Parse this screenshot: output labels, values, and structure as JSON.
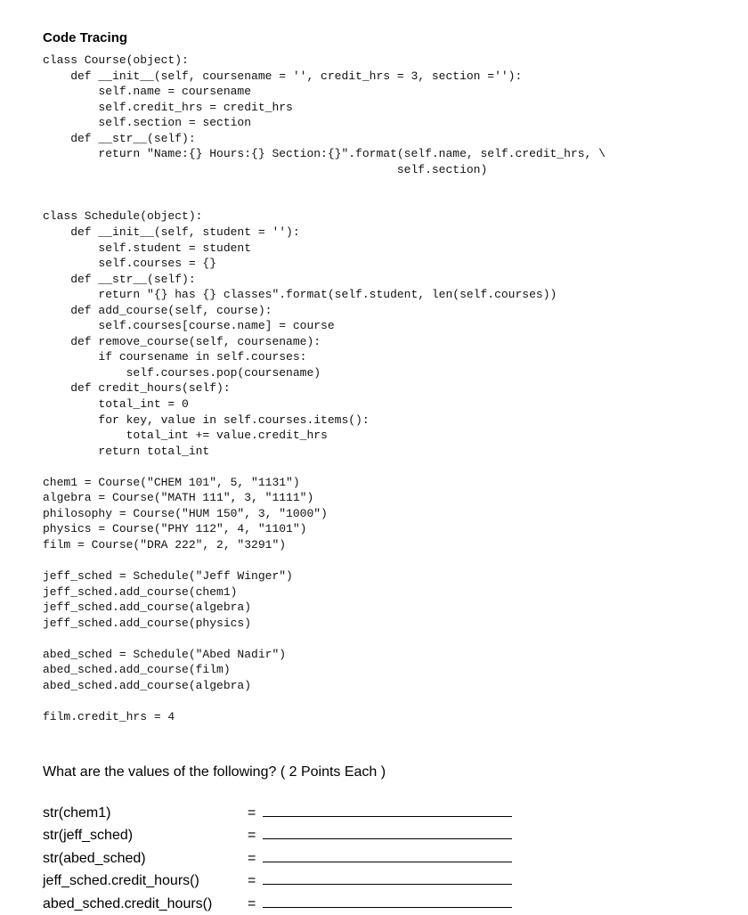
{
  "title": "Code Tracing",
  "code_lines": [
    "class Course(object):",
    "    def __init__(self, coursename = '', credit_hrs = 3, section =''):",
    "        self.name = coursename",
    "        self.credit_hrs = credit_hrs",
    "        self.section = section",
    "    def __str__(self):",
    "        return \"Name:{} Hours:{} Section:{}\".format(self.name, self.credit_hrs, \\",
    "                                                   self.section)",
    "",
    "",
    "class Schedule(object):",
    "    def __init__(self, student = ''):",
    "        self.student = student",
    "        self.courses = {}",
    "    def __str__(self):",
    "        return \"{} has {} classes\".format(self.student, len(self.courses))",
    "    def add_course(self, course):",
    "        self.courses[course.name] = course",
    "    def remove_course(self, coursename):",
    "        if coursename in self.courses:",
    "            self.courses.pop(coursename)",
    "    def credit_hours(self):",
    "        total_int = 0",
    "        for key, value in self.courses.items():",
    "            total_int += value.credit_hrs",
    "        return total_int",
    "",
    "chem1 = Course(\"CHEM 101\", 5, \"1131\")",
    "algebra = Course(\"MATH 111\", 3, \"1111\")",
    "philosophy = Course(\"HUM 150\", 3, \"1000\")",
    "physics = Course(\"PHY 112\", 4, \"1101\")",
    "film = Course(\"DRA 222\", 2, \"3291\")",
    "",
    "jeff_sched = Schedule(\"Jeff Winger\")",
    "jeff_sched.add_course(chem1)",
    "jeff_sched.add_course(algebra)",
    "jeff_sched.add_course(physics)",
    "",
    "abed_sched = Schedule(\"Abed Nadir\")",
    "abed_sched.add_course(film)",
    "abed_sched.add_course(algebra)",
    "",
    "film.credit_hrs = 4"
  ],
  "question": "What are the values of the following?    ( 2 Points Each )",
  "answers": [
    {
      "label": "str(chem1)",
      "equals": "="
    },
    {
      "label": "str(jeff_sched)",
      "equals": "="
    },
    {
      "label": "str(abed_sched)",
      "equals": "="
    },
    {
      "label": "jeff_sched.credit_hours()",
      "equals": "="
    },
    {
      "label": "abed_sched.credit_hours()",
      "equals": "="
    }
  ]
}
